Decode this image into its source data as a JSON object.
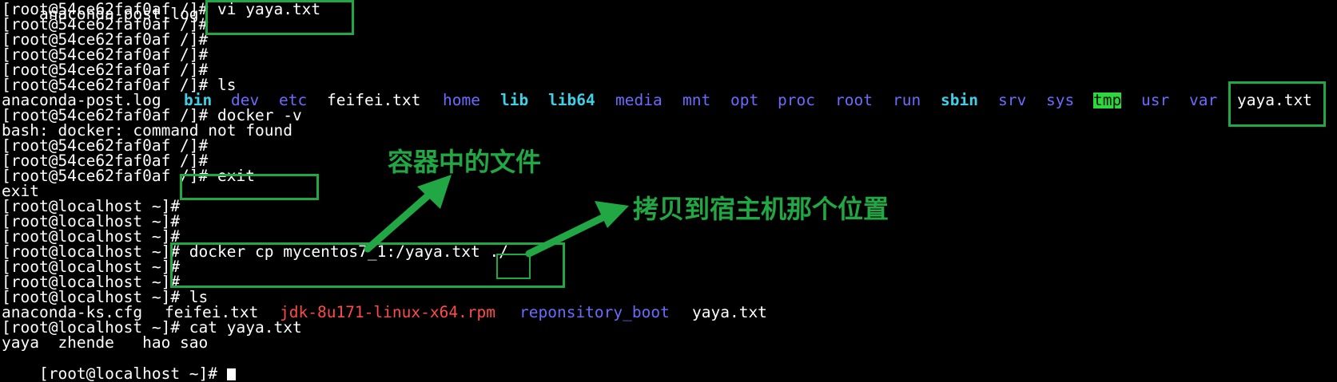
{
  "terminal": {
    "lines": [
      {
        "text": "[root@54ce62faf0af /]# vi yaya.txt"
      },
      {
        "text": "[root@54ce62faf0af /]#"
      },
      {
        "text": "[root@54ce62faf0af /]#"
      },
      {
        "text": "[root@54ce62faf0af /]#"
      },
      {
        "text": "[root@54ce62faf0af /]#"
      },
      {
        "text": "[root@54ce62faf0af /]# ls"
      },
      {
        "text": ""
      },
      {
        "text": "[root@54ce62faf0af /]# docker -v"
      },
      {
        "text": "bash: docker: command not found"
      },
      {
        "text": "[root@54ce62faf0af /]#"
      },
      {
        "text": "[root@54ce62faf0af /]#"
      },
      {
        "text": "[root@54ce62faf0af /]# exit"
      },
      {
        "text": "exit"
      },
      {
        "text": "[root@localhost ~]#"
      },
      {
        "text": "[root@localhost ~]#"
      },
      {
        "text": "[root@localhost ~]#"
      },
      {
        "text": "[root@localhost ~]# docker cp mycentos7_1:/yaya.txt ./"
      },
      {
        "text": "[root@localhost ~]#"
      },
      {
        "text": "[root@localhost ~]#"
      },
      {
        "text": "[root@localhost ~]# ls"
      },
      {
        "text": ""
      },
      {
        "text": "[root@localhost ~]# cat yaya.txt"
      },
      {
        "text": "yaya  zhende   hao sao"
      },
      {
        "text": "[root@localhost ~]# "
      }
    ],
    "top_partial_items": [
      "anaconda-post.log",
      "bin",
      "dev",
      "etc",
      "feifei.txt",
      "home",
      "lib",
      "lib64",
      "media",
      "mnt",
      "opt",
      "proc",
      "root",
      "run",
      "sbin",
      "srv",
      "sys",
      "tmp",
      "usr",
      "var"
    ],
    "container_ls": [
      {
        "name": "anaconda-post.log",
        "color": "#ffffff"
      },
      {
        "name": "bin",
        "color": "#3fd0e8"
      },
      {
        "name": "dev",
        "color": "#6b6bff"
      },
      {
        "name": "etc",
        "color": "#6b6bff"
      },
      {
        "name": "feifei.txt",
        "color": "#ffffff"
      },
      {
        "name": "home",
        "color": "#6b6bff"
      },
      {
        "name": "lib",
        "color": "#3fd0e8"
      },
      {
        "name": "lib64",
        "color": "#3fd0e8"
      },
      {
        "name": "media",
        "color": "#6b6bff"
      },
      {
        "name": "mnt",
        "color": "#6b6bff"
      },
      {
        "name": "opt",
        "color": "#6b6bff"
      },
      {
        "name": "proc",
        "color": "#6b6bff"
      },
      {
        "name": "root",
        "color": "#6b6bff"
      },
      {
        "name": "run",
        "color": "#6b6bff"
      },
      {
        "name": "sbin",
        "color": "#3fd0e8"
      },
      {
        "name": "srv",
        "color": "#6b6bff"
      },
      {
        "name": "sys",
        "color": "#6b6bff"
      },
      {
        "name": "tmp",
        "color": "#2dd93a"
      },
      {
        "name": "usr",
        "color": "#6b6bff"
      },
      {
        "name": "var",
        "color": "#6b6bff"
      },
      {
        "name": "yaya.txt",
        "color": "#ffffff"
      }
    ],
    "host_ls": [
      {
        "name": "anaconda-ks.cfg",
        "color": "#ffffff"
      },
      {
        "name": "feifei.txt",
        "color": "#ffffff"
      },
      {
        "name": "jdk-8u171-linux-x64.rpm",
        "color": "#ff4a4a"
      },
      {
        "name": "reponsitory_boot",
        "color": "#6b6bff"
      },
      {
        "name": "yaya.txt",
        "color": "#ffffff"
      }
    ]
  },
  "annotations": {
    "container_file": "容器中的文件",
    "copy_destination": "拷贝到宿主机那个位置"
  },
  "colors": {
    "highlight": "#21a844",
    "background": "#000000"
  }
}
